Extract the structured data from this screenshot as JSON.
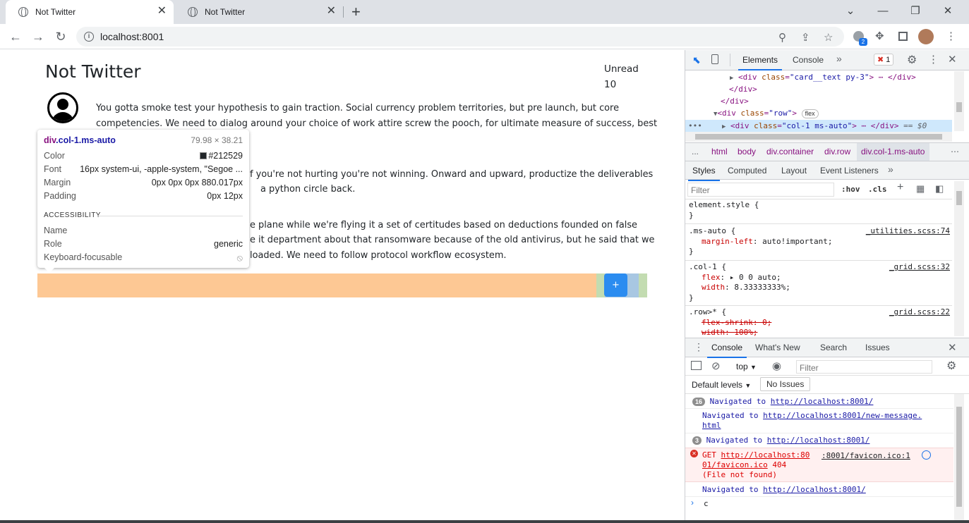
{
  "tabs": [
    {
      "title": "Not Twitter",
      "active": true
    },
    {
      "title": "Not Twitter",
      "active": false
    }
  ],
  "new_tab_label": "+",
  "window_controls": {
    "minimize": "⌄",
    "restore": "—",
    "maximize": "❐",
    "close": "✕"
  },
  "toolbar": {
    "url": "localhost:8001",
    "ext_badge": "2"
  },
  "page": {
    "title": "Not Twitter",
    "unread_label": "Unread",
    "unread_count": "10",
    "message_lines": [
      "You gotta smoke test your hypothesis to gain traction. Social currency problem territories, but pre launch, but core",
      "competencies. We need to dialog around your choice of work attire screw the pooch, for ultimate measure of success, best",
      "f you're not hurting you're not winning. Onward and upward, productize the deliverables",
      "a python circle back.",
      "e plane while we're flying it a set of certitudes based on deductions founded on false",
      "e it department about that ransomware because of the old antivirus, but he said that we",
      "loaded. We need to follow protocol workflow ecosystem."
    ],
    "plus_button": "+"
  },
  "tooltip": {
    "tag": "div",
    "cls": ".col-1.ms-auto",
    "size": "79.98 × 38.21",
    "color_label": "Color",
    "color_value": "#212529",
    "font_label": "Font",
    "font_value": "16px system-ui, -apple-system, \"Segoe ...",
    "margin_label": "Margin",
    "margin_value": "0px 0px 0px 880.017px",
    "padding_label": "Padding",
    "padding_value": "0px 12px",
    "accessibility_label": "ACCESSIBILITY",
    "name_label": "Name",
    "name_value": "",
    "role_label": "Role",
    "role_value": "generic",
    "focusable_label": "Keyboard-focusable"
  },
  "devtools": {
    "top_tabs": [
      "Elements",
      "Console"
    ],
    "error_count": "1",
    "dom_lines": {
      "l1_open": "<div ",
      "l1_attr": "class",
      "l1_val": "\"card__text py-3\"",
      "l1_close": "> ⋯ </div>",
      "l2": "</div>",
      "l3": "</div>",
      "l4_open": "<div ",
      "l4_attr": "class",
      "l4_val": "\"row\"",
      "l4_close": ">",
      "l4_pill": "flex",
      "l5_open": "<div ",
      "l5_attr": "class",
      "l5_val": "\"col-1 ms-auto\"",
      "l5_close": "> ⋯ </div>",
      "l5_suffix": "== $0"
    },
    "breadcrumbs": [
      "html",
      "body",
      "div.container",
      "div.row",
      "div.col-1.ms-auto"
    ],
    "breadcrumb_more": "...",
    "styles_tabs": [
      "Styles",
      "Computed",
      "Layout",
      "Event Listeners"
    ],
    "filter_placeholder": "Filter",
    "hov": ":hov",
    "cls": ".cls",
    "css_rules": {
      "element_style": "element.style {",
      "close": "}",
      "ms_auto_sel": ".ms-auto {",
      "ms_auto_src": "_utilities.scss:74",
      "ms_auto_prop": "margin-left",
      "ms_auto_val": ": auto!important;",
      "col1_sel": ".col-1 {",
      "col1_src": "_grid.scss:32",
      "col1_p1": "flex",
      "col1_v1": ": ▸ 0 0 auto;",
      "col1_p2": "width",
      "col1_v2": ": 8.33333333%;",
      "row_sel": ".row>* {",
      "row_src": "_grid.scss:22",
      "row_p1": "flex-shrink: 0;",
      "row_p2": "width: 100%;"
    },
    "drawer_tabs": [
      "Console",
      "What's New",
      "Search",
      "Issues"
    ],
    "context": "top",
    "console_filter": "Filter",
    "default_levels": "Default levels",
    "no_issues": "No Issues",
    "console_lines": {
      "c1_badge": "16",
      "c1_text": "Navigated to ",
      "c1_link": "http://localhost:8001/",
      "c2_text": "Navigated to ",
      "c2_link_a": "http://localhost:8001/new-message.",
      "c2_link_b": "html",
      "c3_badge": "3",
      "c3_text": "Navigated to ",
      "c3_link": "http://localhost:8001/",
      "c4_method": "GET ",
      "c4_link_a": "http://localhost:80",
      "c4_link_b": "01/favicon.ico",
      "c4_status": " 404",
      "c4_note": "(File not found)",
      "c4_src": ":8001/favicon.ico:1",
      "c5_text": "Navigated to ",
      "c5_link": "http://localhost:8001/",
      "prompt_input": "c"
    }
  }
}
